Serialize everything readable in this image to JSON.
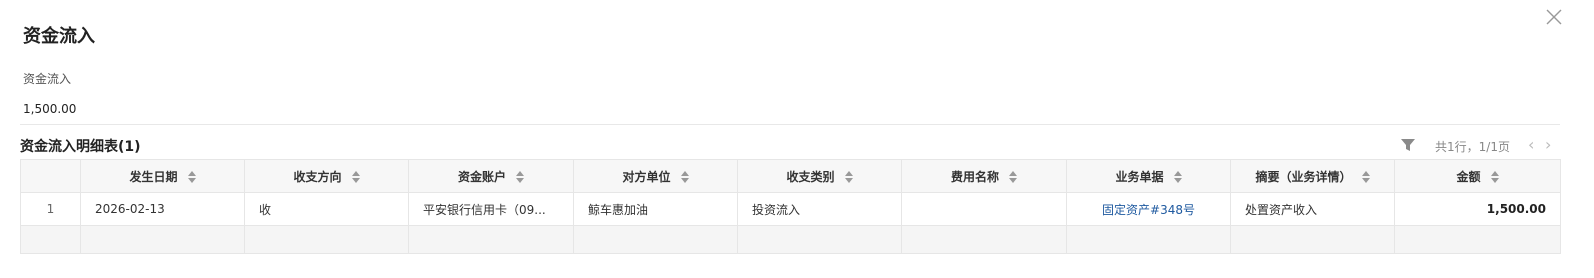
{
  "dialog": {
    "title": "资金流入",
    "field_label": "资金流入",
    "field_value": "1,500.00"
  },
  "detail": {
    "title": "资金流入明细表(1)",
    "pager_text": "共1行，1/1页",
    "prev_glyph": "‹",
    "next_glyph": "›"
  },
  "table": {
    "columns": [
      "",
      "发生日期",
      "收支方向",
      "资金账户",
      "对方单位",
      "收支类别",
      "费用名称",
      "业务单据",
      "摘要（业务详情）",
      "金额"
    ],
    "rows": [
      [
        "1",
        "2026-02-13",
        "收",
        "平安银行信用卡（09...",
        "鲸车惠加油",
        "投资流入",
        "",
        "固定资产#348号",
        "处置资产收入",
        "1,500.00"
      ]
    ]
  },
  "colors": {
    "link": "#1f5aa0",
    "header_bg": "#f7f7f7"
  },
  "icons": [
    "close-icon",
    "filter-icon",
    "sort-icon"
  ]
}
